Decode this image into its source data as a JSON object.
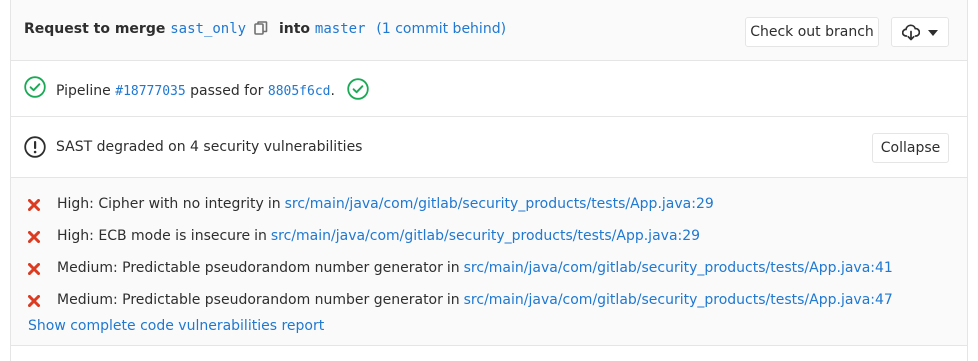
{
  "header": {
    "title_prefix": "Request to merge",
    "source_branch": "sast_only",
    "into_word": "into",
    "target_branch": "master",
    "behind_text": "(1 commit behind)",
    "checkout_label": "Check out branch"
  },
  "pipeline": {
    "prefix": "Pipeline",
    "id": "#18777035",
    "middle": "passed for",
    "commit": "8805f6cd",
    "suffix": ".",
    "status_color": "#1aaa55"
  },
  "sast": {
    "summary": "SAST degraded on 4 security vulnerabilities",
    "collapse_label": "Collapse"
  },
  "vulnerabilities": [
    {
      "text": "High: Cipher with no integrity",
      "in": "in",
      "path": "src/main/java/com/gitlab/security_products/tests/App.java:29"
    },
    {
      "text": "High: ECB mode is insecure",
      "in": "in",
      "path": "src/main/java/com/gitlab/security_products/tests/App.java:29"
    },
    {
      "text": "Medium: Predictable pseudorandom number generator",
      "in": "in",
      "path": "src/main/java/com/gitlab/security_products/tests/App.java:41"
    },
    {
      "text": "Medium: Predictable pseudorandom number generator",
      "in": "in",
      "path": "src/main/java/com/gitlab/security_products/tests/App.java:47"
    }
  ],
  "report_link": "Show complete code vulnerabilities report",
  "colors": {
    "link": "#1f78d1",
    "danger": "#db3b21",
    "success": "#1aaa55",
    "border": "#e5e5e5",
    "panel_bg": "#fafafa"
  },
  "icons": {
    "copy": "clipboard-icon",
    "download": "download-cloud-icon",
    "dropdown": "chevron-down-icon",
    "pipeline_status": "status-success-icon",
    "warning": "warning-circle-icon",
    "vulnerability": "close-x-icon"
  }
}
